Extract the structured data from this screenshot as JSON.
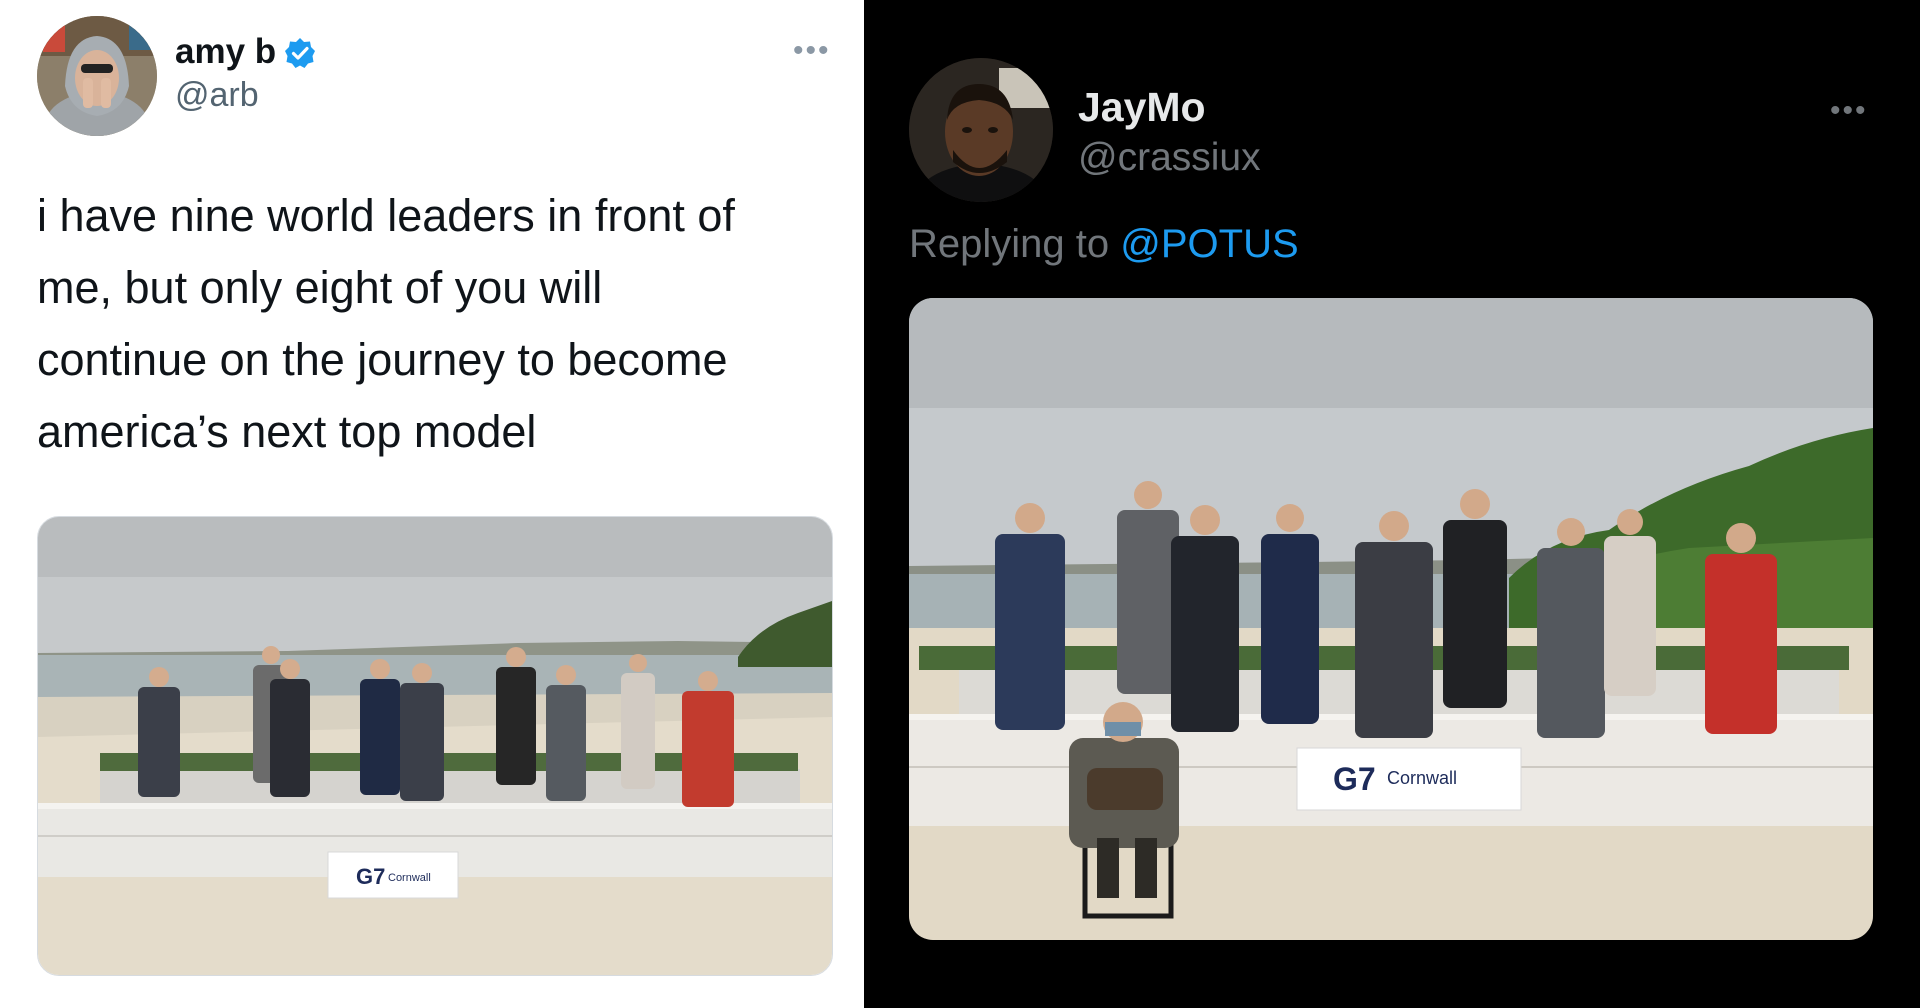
{
  "colors": {
    "light_bg": "#ffffff",
    "dark_bg": "#000000",
    "link_blue": "#1d9bf0",
    "verified_blue": "#1d9bf0",
    "text_dark": "#0f1419",
    "text_light": "#e7e9ea"
  },
  "left_tweet": {
    "author": {
      "display_name": "amy b",
      "handle": "@arb",
      "verified": true
    },
    "more_icon": "more-horizontal-icon",
    "text": "i have nine world leaders in front of\nme, but only eight of you will\ncontinue on the journey to become\namerica’s next top model",
    "photo": {
      "sign_logo": "G7",
      "sign_text": "Cornwall"
    }
  },
  "right_tweet": {
    "author": {
      "display_name": "JayMo",
      "handle": "@crassiux"
    },
    "more_icon": "more-horizontal-icon",
    "reply": {
      "prefix": "Replying to",
      "mention": "@POTUS"
    },
    "photo": {
      "sign_logo": "G7",
      "sign_text": "Cornwall"
    }
  }
}
